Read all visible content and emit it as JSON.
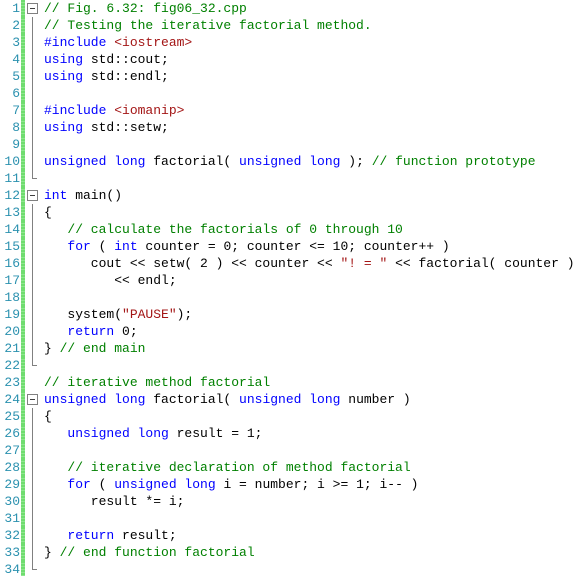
{
  "editor": {
    "name": "code-editor",
    "language": "C++",
    "first_line": 1,
    "last_line": 34,
    "colors": {
      "background": "#ffffff",
      "line_number": "#2B91AF",
      "keyword": "#0000FF",
      "comment": "#008000",
      "string": "#A31515",
      "plain": "#000000",
      "change_bar": "#6FDC6F",
      "fold_marker": "#808080"
    }
  },
  "lines": [
    {
      "n": "1",
      "fold": "box",
      "tokens": [
        {
          "t": "// Fig. 6.32: fig06_32.cpp",
          "c": "cm"
        }
      ]
    },
    {
      "n": "2",
      "fold": "line",
      "tokens": [
        {
          "t": "// Testing the iterative factorial method.",
          "c": "cm"
        }
      ]
    },
    {
      "n": "3",
      "fold": "line",
      "tokens": [
        {
          "t": "#include ",
          "c": "pp"
        },
        {
          "t": "<iostream>",
          "c": "inc"
        }
      ]
    },
    {
      "n": "4",
      "fold": "line",
      "tokens": [
        {
          "t": "using",
          "c": "kw"
        },
        {
          "t": " std::cout;",
          "c": "pl"
        }
      ]
    },
    {
      "n": "5",
      "fold": "line",
      "tokens": [
        {
          "t": "using",
          "c": "kw"
        },
        {
          "t": " std::endl;",
          "c": "pl"
        }
      ]
    },
    {
      "n": "6",
      "fold": "line",
      "tokens": [
        {
          "t": "",
          "c": "pl"
        }
      ]
    },
    {
      "n": "7",
      "fold": "line",
      "tokens": [
        {
          "t": "#include ",
          "c": "pp"
        },
        {
          "t": "<iomanip>",
          "c": "inc"
        }
      ]
    },
    {
      "n": "8",
      "fold": "line",
      "tokens": [
        {
          "t": "using",
          "c": "kw"
        },
        {
          "t": " std::setw;",
          "c": "pl"
        }
      ]
    },
    {
      "n": "9",
      "fold": "line",
      "tokens": [
        {
          "t": "",
          "c": "pl"
        }
      ]
    },
    {
      "n": "10",
      "fold": "line",
      "tokens": [
        {
          "t": "unsigned long",
          "c": "kw"
        },
        {
          "t": " factorial( ",
          "c": "pl"
        },
        {
          "t": "unsigned long",
          "c": "kw"
        },
        {
          "t": " ); ",
          "c": "pl"
        },
        {
          "t": "// function prototype",
          "c": "cm"
        }
      ]
    },
    {
      "n": "11",
      "fold": "end",
      "tokens": [
        {
          "t": "",
          "c": "pl"
        }
      ]
    },
    {
      "n": "12",
      "fold": "box",
      "tokens": [
        {
          "t": "int",
          "c": "kw"
        },
        {
          "t": " main()",
          "c": "pl"
        }
      ]
    },
    {
      "n": "13",
      "fold": "line",
      "tokens": [
        {
          "t": "{",
          "c": "pl"
        }
      ]
    },
    {
      "n": "14",
      "fold": "line",
      "tokens": [
        {
          "t": "   // calculate the factorials of 0 through 10",
          "c": "cm"
        }
      ]
    },
    {
      "n": "15",
      "fold": "line",
      "tokens": [
        {
          "t": "   ",
          "c": "pl"
        },
        {
          "t": "for",
          "c": "kw"
        },
        {
          "t": " ( ",
          "c": "pl"
        },
        {
          "t": "int",
          "c": "kw"
        },
        {
          "t": " counter = 0; counter <= 10; counter++ )",
          "c": "pl"
        }
      ]
    },
    {
      "n": "16",
      "fold": "line",
      "tokens": [
        {
          "t": "      cout << setw( 2 ) << counter << ",
          "c": "pl"
        },
        {
          "t": "\"! = \"",
          "c": "str"
        },
        {
          "t": " << factorial( counter )",
          "c": "pl"
        }
      ]
    },
    {
      "n": "17",
      "fold": "line",
      "tokens": [
        {
          "t": "         << endl;",
          "c": "pl"
        }
      ]
    },
    {
      "n": "18",
      "fold": "line",
      "tokens": [
        {
          "t": "",
          "c": "pl"
        }
      ]
    },
    {
      "n": "19",
      "fold": "line",
      "tokens": [
        {
          "t": "   system(",
          "c": "pl"
        },
        {
          "t": "\"PAUSE\"",
          "c": "str"
        },
        {
          "t": ");",
          "c": "pl"
        }
      ]
    },
    {
      "n": "20",
      "fold": "line",
      "tokens": [
        {
          "t": "   ",
          "c": "pl"
        },
        {
          "t": "return",
          "c": "kw"
        },
        {
          "t": " 0;",
          "c": "pl"
        }
      ]
    },
    {
      "n": "21",
      "fold": "line",
      "tokens": [
        {
          "t": "} ",
          "c": "pl"
        },
        {
          "t": "// end main",
          "c": "cm"
        }
      ]
    },
    {
      "n": "22",
      "fold": "end",
      "tokens": [
        {
          "t": "",
          "c": "pl"
        }
      ]
    },
    {
      "n": "23",
      "fold": "none",
      "tokens": [
        {
          "t": "// iterative method factorial",
          "c": "cm"
        }
      ]
    },
    {
      "n": "24",
      "fold": "box",
      "tokens": [
        {
          "t": "unsigned long",
          "c": "kw"
        },
        {
          "t": " factorial( ",
          "c": "pl"
        },
        {
          "t": "unsigned long",
          "c": "kw"
        },
        {
          "t": " number )",
          "c": "pl"
        }
      ]
    },
    {
      "n": "25",
      "fold": "line",
      "tokens": [
        {
          "t": "{",
          "c": "pl"
        }
      ]
    },
    {
      "n": "26",
      "fold": "line",
      "tokens": [
        {
          "t": "   ",
          "c": "pl"
        },
        {
          "t": "unsigned long",
          "c": "kw"
        },
        {
          "t": " result = 1;",
          "c": "pl"
        }
      ]
    },
    {
      "n": "27",
      "fold": "line",
      "tokens": [
        {
          "t": "",
          "c": "pl"
        }
      ]
    },
    {
      "n": "28",
      "fold": "line",
      "tokens": [
        {
          "t": "   // iterative declaration of method factorial",
          "c": "cm"
        }
      ]
    },
    {
      "n": "29",
      "fold": "line",
      "tokens": [
        {
          "t": "   ",
          "c": "pl"
        },
        {
          "t": "for",
          "c": "kw"
        },
        {
          "t": " ( ",
          "c": "pl"
        },
        {
          "t": "unsigned long",
          "c": "kw"
        },
        {
          "t": " i = number; i >= 1; i-- )",
          "c": "pl"
        }
      ]
    },
    {
      "n": "30",
      "fold": "line",
      "tokens": [
        {
          "t": "      result *= i;",
          "c": "pl"
        }
      ]
    },
    {
      "n": "31",
      "fold": "line",
      "tokens": [
        {
          "t": "",
          "c": "pl"
        }
      ]
    },
    {
      "n": "32",
      "fold": "line",
      "tokens": [
        {
          "t": "   ",
          "c": "pl"
        },
        {
          "t": "return",
          "c": "kw"
        },
        {
          "t": " result;",
          "c": "pl"
        }
      ]
    },
    {
      "n": "33",
      "fold": "line",
      "tokens": [
        {
          "t": "} ",
          "c": "pl"
        },
        {
          "t": "// end function factorial",
          "c": "cm"
        }
      ]
    },
    {
      "n": "34",
      "fold": "end",
      "tokens": [
        {
          "t": "",
          "c": "pl"
        }
      ]
    }
  ]
}
